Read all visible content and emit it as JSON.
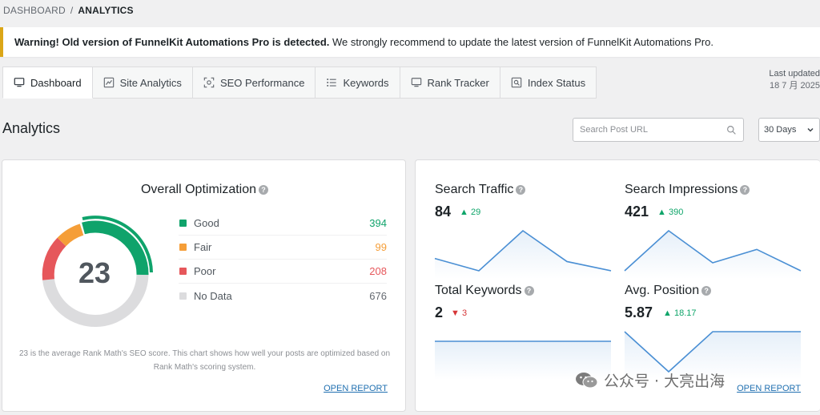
{
  "breadcrumb": {
    "parent": "DASHBOARD",
    "separator": "/",
    "current": "ANALYTICS"
  },
  "notice": {
    "bold_text": "Warning! Old version of FunnelKit Automations Pro is detected.",
    "text": " We strongly recommend to update the latest version of FunnelKit Automations Pro."
  },
  "tabs": [
    {
      "label": "Dashboard",
      "icon": "monitor-icon",
      "active": true
    },
    {
      "label": "Site Analytics",
      "icon": "chart-icon",
      "active": false
    },
    {
      "label": "SEO Performance",
      "icon": "target-icon",
      "active": false
    },
    {
      "label": "Keywords",
      "icon": "list-icon",
      "active": false
    },
    {
      "label": "Rank Tracker",
      "icon": "monitor-icon",
      "active": false
    },
    {
      "label": "Index Status",
      "icon": "search-icon",
      "active": false
    }
  ],
  "last_updated": {
    "label": "Last updated",
    "value": "18 7 月 2025"
  },
  "page_title": "Analytics",
  "search": {
    "placeholder": "Search Post URL"
  },
  "range": {
    "selected": "30 Days"
  },
  "overall": {
    "title": "Overall Optimization",
    "score": "23",
    "legend": [
      {
        "label": "Good",
        "value": "394",
        "color": "#0fa36b"
      },
      {
        "label": "Fair",
        "value": "99",
        "color": "#f59e38"
      },
      {
        "label": "Poor",
        "value": "208",
        "color": "#e6575b"
      },
      {
        "label": "No Data",
        "value": "676",
        "color": "#dcdcde"
      }
    ],
    "description": "23 is the average Rank Math's SEO score. This chart shows how well your posts are optimized based on Rank Math's scoring system.",
    "open_report": "OPEN REPORT"
  },
  "stats": [
    {
      "label": "Search Traffic",
      "value": "84",
      "delta": "29",
      "direction": "up",
      "trend": [
        5,
        1,
        14,
        4,
        1
      ]
    },
    {
      "label": "Search Impressions",
      "value": "421",
      "delta": "390",
      "direction": "up",
      "trend": [
        1,
        16,
        4,
        9,
        1
      ]
    },
    {
      "label": "Total Keywords",
      "value": "2",
      "delta": "3",
      "direction": "down",
      "trend": [
        1,
        1,
        1,
        1,
        1
      ]
    },
    {
      "label": "Avg. Position",
      "value": "5.87",
      "delta": "18.17",
      "direction": "up",
      "trend": [
        10,
        50,
        10,
        10,
        10
      ]
    }
  ],
  "open_report_right": "OPEN REPORT",
  "watermark": "公众号 · 大亮出海",
  "colors": {
    "accent": "#2271b1",
    "good": "#0fa36b",
    "fair": "#f59e38",
    "poor": "#e6575b",
    "nodata": "#dcdcde",
    "spark": "#4a8fd4"
  }
}
